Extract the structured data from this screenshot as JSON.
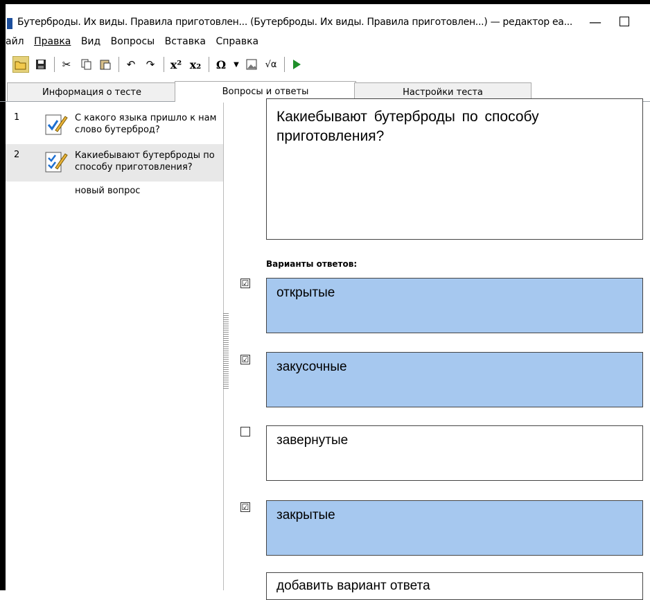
{
  "window": {
    "title": "Бутерброды. Их виды. Правила приготовлен... (Бутерброды. Их виды. Правила приготовлен...) — редактор еа...",
    "minimize": "—"
  },
  "menu": [
    "айл",
    "Правка",
    "Вид",
    "Вопросы",
    "Вставка",
    "Справка"
  ],
  "toolbar": {
    "icons": [
      "open-folder-icon",
      "save-icon",
      "cut-icon",
      "copy-icon",
      "paste-icon",
      "undo-icon",
      "redo-icon",
      "superscript-icon",
      "subscript-icon",
      "symbol-icon",
      "dropdown-arrow-icon",
      "image-icon",
      "formula-icon",
      "play-icon"
    ],
    "superscript": "x²",
    "subscript": "x₂",
    "symbol": "Ω",
    "formula": "√α"
  },
  "tabs": [
    {
      "label": "Информация о тесте",
      "active": false
    },
    {
      "label": "Вопросы и ответы",
      "active": true
    },
    {
      "label": "Настройки теста",
      "active": false
    }
  ],
  "questions": [
    {
      "num": "1",
      "text": "С какого языка пришло к нам слово бутерброд?"
    },
    {
      "num": "2",
      "text": "Какиебывают бутерброды по способу приготовления?"
    }
  ],
  "new_question": "новый вопрос",
  "question_text": "Какиебывают  бутерброды  по способу приготовления?",
  "variants_label": "Варианты ответов:",
  "answers": [
    {
      "text": "открытые",
      "checked": true
    },
    {
      "text": "закусочные",
      "checked": true
    },
    {
      "text": "завернутые",
      "checked": false
    },
    {
      "text": "закрытые",
      "checked": true
    }
  ],
  "check_mark": "☑",
  "add_answer": "добавить вариант ответа",
  "colors": {
    "selected_answer": "#a6c8ef"
  }
}
